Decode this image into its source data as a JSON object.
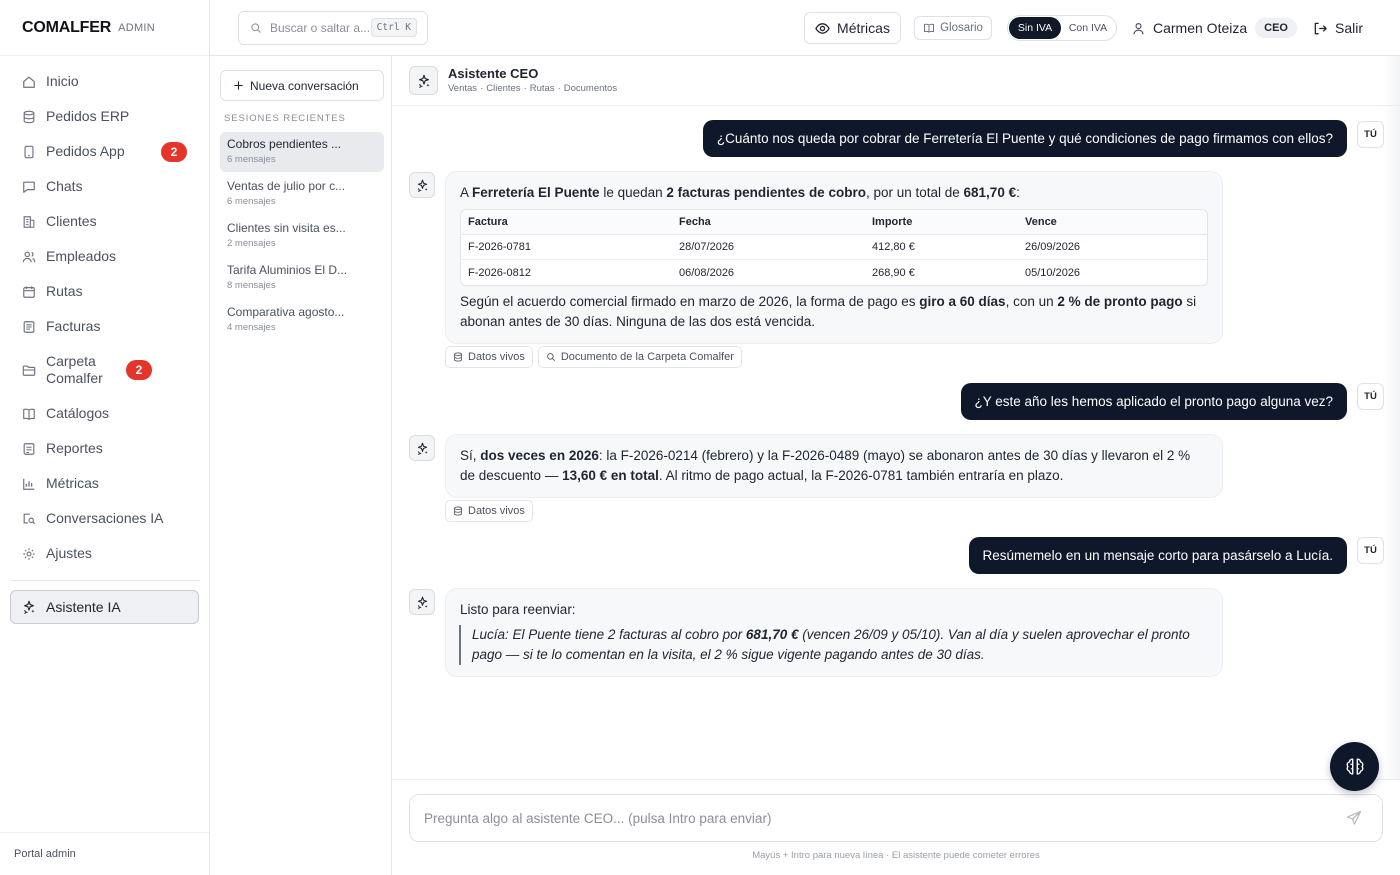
{
  "brand": {
    "name": "COMALFER",
    "role": "ADMIN"
  },
  "sidebar": {
    "items": [
      {
        "label": "Inicio",
        "icon": "home-icon"
      },
      {
        "label": "Pedidos ERP",
        "icon": "database-icon"
      },
      {
        "label": "Pedidos App",
        "icon": "phone-icon",
        "badge": "2"
      },
      {
        "label": "Chats",
        "icon": "chat-icon"
      },
      {
        "label": "Clientes",
        "icon": "building-icon"
      },
      {
        "label": "Empleados",
        "icon": "users-icon"
      },
      {
        "label": "Rutas",
        "icon": "calendar-icon"
      },
      {
        "label": "Facturas",
        "icon": "invoice-icon"
      },
      {
        "label": "Carpeta Comalfer",
        "icon": "folder-icon",
        "badge": "2"
      },
      {
        "label": "Catálogos",
        "icon": "book-icon"
      },
      {
        "label": "Reportes",
        "icon": "report-icon"
      },
      {
        "label": "Métricas",
        "icon": "bar-chart-icon"
      },
      {
        "label": "Conversaciones IA",
        "icon": "search-doc-icon"
      },
      {
        "label": "Ajustes",
        "icon": "gear-icon"
      }
    ],
    "active": {
      "label": "Asistente IA",
      "icon": "sparkle-icon"
    },
    "footer": "Portal admin"
  },
  "topbar": {
    "search_placeholder": "Buscar o saltar a...",
    "shortcut": "Ctrl K",
    "metricas_label": "Métricas",
    "glosario_label": "Glosario",
    "iva_off": "Sin IVA",
    "iva_on": "Con IVA",
    "user_name": "Carmen Oteiza",
    "user_role": "CEO",
    "logout_label": "Salir"
  },
  "sessions": {
    "new_label": "Nueva conversación",
    "title": "SESIONES RECIENTES",
    "items": [
      {
        "title": "Cobros pendientes ...",
        "meta": "6 mensajes"
      },
      {
        "title": "Ventas de julio por c...",
        "meta": "6 mensajes"
      },
      {
        "title": "Clientes sin visita es...",
        "meta": "2 mensajes"
      },
      {
        "title": "Tarifa Aluminios El D...",
        "meta": "8 mensajes"
      },
      {
        "title": "Comparativa agosto...",
        "meta": "4 mensajes"
      }
    ]
  },
  "chat": {
    "title": "Asistente CEO",
    "scopes": [
      "Ventas",
      "Clientes",
      "Rutas",
      "Documentos"
    ],
    "user_tag": "TÚ",
    "messages": {
      "u1": "¿Cuánto nos queda por cobrar de Ferretería El Puente y qué condiciones de pago firmamos con ellos?",
      "b1": {
        "p1_a": "A ",
        "p1_b": "Ferretería El Puente",
        "p1_c": " le quedan ",
        "p1_d": "2 facturas pendientes de cobro",
        "p1_e": ", por un total de ",
        "p1_f": "681,70 €",
        "p1_g": ":",
        "table": {
          "headers": [
            "Factura",
            "Fecha",
            "Importe",
            "Vence"
          ],
          "rows": [
            [
              "F-2026-0781",
              "28/07/2026",
              "412,80 €",
              "26/09/2026"
            ],
            [
              "F-2026-0812",
              "06/08/2026",
              "268,90 €",
              "05/10/2026"
            ]
          ]
        },
        "p2_a": "Según el acuerdo comercial firmado en marzo de 2026, la forma de pago es ",
        "p2_b": "giro a 60 días",
        "p2_c": ", con un ",
        "p2_d": "2 % de pronto pago",
        "p2_e": " si abonan antes de 30 días. Ninguna de las dos está vencida.",
        "chips": [
          "Datos vivos",
          "Documento de la Carpeta Comalfer"
        ]
      },
      "u2": "¿Y este año les hemos aplicado el pronto pago alguna vez?",
      "b2": {
        "a": "Sí, ",
        "b": "dos veces en 2026",
        "c": ": la F-2026-0214 (febrero) y la F-2026-0489 (mayo) se abonaron antes de 30 días y llevaron el 2 % de descuento — ",
        "d": "13,60 € en total",
        "e": ". Al ritmo de pago actual, la F-2026-0781 también entraría en plazo.",
        "chips": [
          "Datos vivos"
        ]
      },
      "u3": "Resúmemelo en un mensaje corto para pasárselo a Lucía.",
      "b3": {
        "intro": "Listo para reenviar:",
        "q_a": "Lucía: El Puente tiene 2 facturas al cobro por ",
        "q_b": "681,70 €",
        "q_c": " (vencen 26/09 y 05/10). Van al día y suelen aprovechar el pronto pago — si te lo comentan en la visita, el 2 % sigue vigente pagando antes de 30 días."
      }
    },
    "composer_placeholder": "Pregunta algo al asistente CEO... (pulsa Intro para enviar)",
    "composer_hint": "Mayús + Intro para nueva línea · El asistente puede cometer errores"
  },
  "colors": {
    "primary_dark": "#0f172a",
    "badge_red": "#e5352b",
    "card_bg": "#f7f8fa"
  }
}
